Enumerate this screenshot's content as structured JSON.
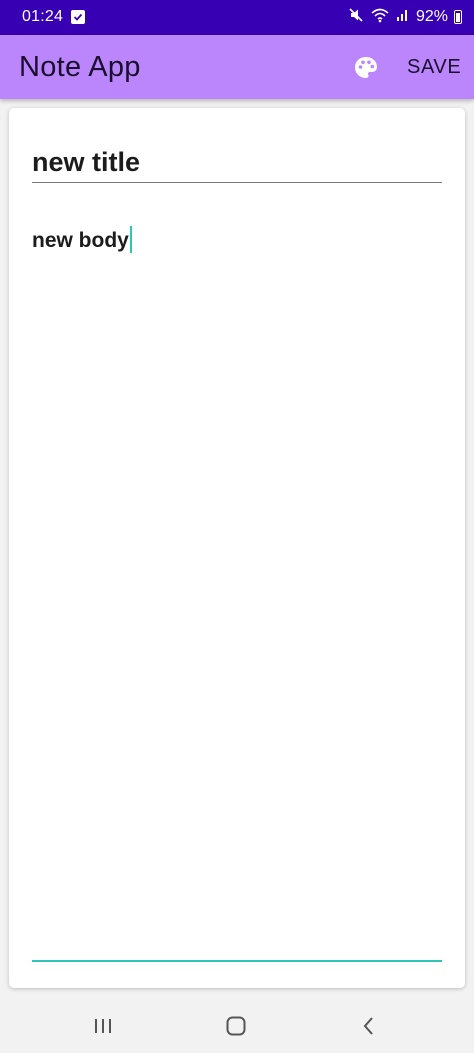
{
  "status_bar": {
    "time": "01:24",
    "battery": "92%",
    "icons": [
      "checkbox-notification-icon",
      "mute-icon",
      "wifi-icon",
      "signal-icon",
      "battery-icon"
    ]
  },
  "app_bar": {
    "title": "Note App",
    "palette_icon": "palette-icon",
    "save_label": "SAVE"
  },
  "note": {
    "title_value": "new title",
    "body_value": "new body"
  },
  "nav_bar": {
    "icons": [
      "recent-apps-icon",
      "home-icon",
      "back-icon"
    ]
  },
  "colors": {
    "status_bar": "#3700b3",
    "app_bar": "#bb86fc",
    "accent": "#2ec4b6",
    "card": "#ffffff"
  }
}
